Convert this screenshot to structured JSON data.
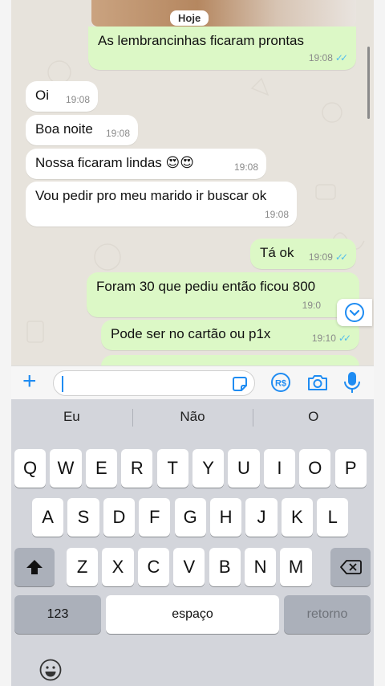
{
  "chat": {
    "day_chip": "Hoje",
    "messages": [
      {
        "dir": "out",
        "text": "As lembrancinhas ficaram prontas",
        "time": "19:08",
        "read": true
      },
      {
        "dir": "in",
        "text": "Oi",
        "time": "19:08"
      },
      {
        "dir": "in",
        "text": "Boa noite",
        "time": "19:08"
      },
      {
        "dir": "in",
        "text": "Nossa ficaram lindas 😍😍",
        "time": "19:08"
      },
      {
        "dir": "in",
        "text": "Vou pedir pro meu marido ir buscar ok",
        "time": "19:08"
      },
      {
        "dir": "out",
        "text": "Tá ok",
        "time": "19:09",
        "read": true
      },
      {
        "dir": "out",
        "text": "Foram 30 que pediu então ficou 800",
        "time": "19:0",
        "read": false
      },
      {
        "dir": "out",
        "text": "Pode ser no cartão ou p1x",
        "time": "19:10",
        "read": true
      }
    ],
    "scroll_down_icon": "chevron-down-circle-icon"
  },
  "input_bar": {
    "attach_icon": "plus-icon",
    "sticker_icon": "sticker-icon",
    "payment_icon": "rs-payment-icon",
    "camera_icon": "camera-icon",
    "mic_icon": "microphone-icon",
    "placeholder": ""
  },
  "keyboard": {
    "suggestions": [
      "Eu",
      "Não",
      "O"
    ],
    "row1": [
      "Q",
      "W",
      "E",
      "R",
      "T",
      "Y",
      "U",
      "I",
      "O",
      "P"
    ],
    "row2": [
      "A",
      "S",
      "D",
      "F",
      "G",
      "H",
      "J",
      "K",
      "L"
    ],
    "row3": [
      "Z",
      "X",
      "C",
      "V",
      "B",
      "N",
      "M"
    ],
    "numbers_key": "123",
    "space_key": "espaço",
    "return_key": "retorno",
    "shift_icon": "shift-icon",
    "delete_icon": "backspace-icon",
    "emoji_icon": "emoji-icon"
  },
  "colors": {
    "accent": "#1f8cf2",
    "outgoing_bubble": "#dcf8c6",
    "incoming_bubble": "#ffffff",
    "read_ticks": "#53bdeb",
    "chat_bg": "#e7e3dc"
  }
}
